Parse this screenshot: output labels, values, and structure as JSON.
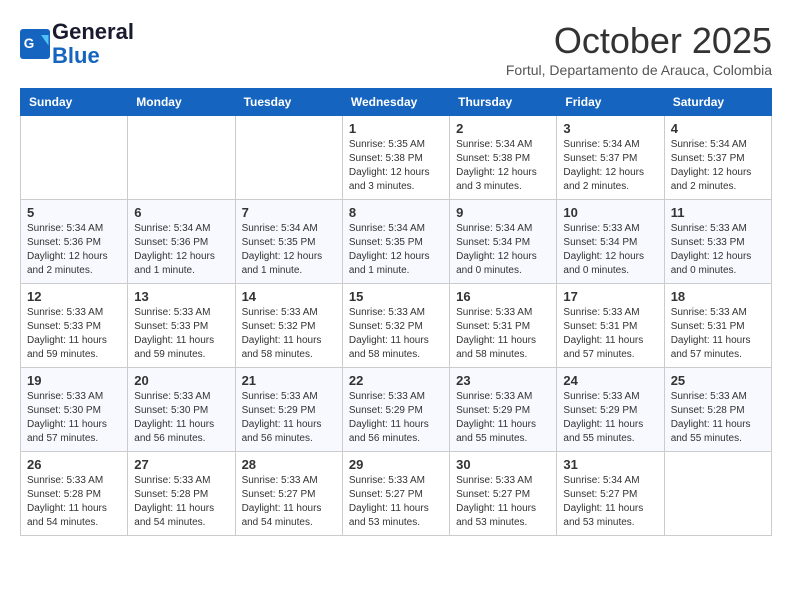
{
  "header": {
    "logo_general": "General",
    "logo_blue": "Blue",
    "month_title": "October 2025",
    "subtitle": "Fortul, Departamento de Arauca, Colombia"
  },
  "days_of_week": [
    "Sunday",
    "Monday",
    "Tuesday",
    "Wednesday",
    "Thursday",
    "Friday",
    "Saturday"
  ],
  "weeks": [
    [
      {
        "day": "",
        "content": ""
      },
      {
        "day": "",
        "content": ""
      },
      {
        "day": "",
        "content": ""
      },
      {
        "day": "1",
        "content": "Sunrise: 5:35 AM\nSunset: 5:38 PM\nDaylight: 12 hours\nand 3 minutes."
      },
      {
        "day": "2",
        "content": "Sunrise: 5:34 AM\nSunset: 5:38 PM\nDaylight: 12 hours\nand 3 minutes."
      },
      {
        "day": "3",
        "content": "Sunrise: 5:34 AM\nSunset: 5:37 PM\nDaylight: 12 hours\nand 2 minutes."
      },
      {
        "day": "4",
        "content": "Sunrise: 5:34 AM\nSunset: 5:37 PM\nDaylight: 12 hours\nand 2 minutes."
      }
    ],
    [
      {
        "day": "5",
        "content": "Sunrise: 5:34 AM\nSunset: 5:36 PM\nDaylight: 12 hours\nand 2 minutes."
      },
      {
        "day": "6",
        "content": "Sunrise: 5:34 AM\nSunset: 5:36 PM\nDaylight: 12 hours\nand 1 minute."
      },
      {
        "day": "7",
        "content": "Sunrise: 5:34 AM\nSunset: 5:35 PM\nDaylight: 12 hours\nand 1 minute."
      },
      {
        "day": "8",
        "content": "Sunrise: 5:34 AM\nSunset: 5:35 PM\nDaylight: 12 hours\nand 1 minute."
      },
      {
        "day": "9",
        "content": "Sunrise: 5:34 AM\nSunset: 5:34 PM\nDaylight: 12 hours\nand 0 minutes."
      },
      {
        "day": "10",
        "content": "Sunrise: 5:33 AM\nSunset: 5:34 PM\nDaylight: 12 hours\nand 0 minutes."
      },
      {
        "day": "11",
        "content": "Sunrise: 5:33 AM\nSunset: 5:33 PM\nDaylight: 12 hours\nand 0 minutes."
      }
    ],
    [
      {
        "day": "12",
        "content": "Sunrise: 5:33 AM\nSunset: 5:33 PM\nDaylight: 11 hours\nand 59 minutes."
      },
      {
        "day": "13",
        "content": "Sunrise: 5:33 AM\nSunset: 5:33 PM\nDaylight: 11 hours\nand 59 minutes."
      },
      {
        "day": "14",
        "content": "Sunrise: 5:33 AM\nSunset: 5:32 PM\nDaylight: 11 hours\nand 58 minutes."
      },
      {
        "day": "15",
        "content": "Sunrise: 5:33 AM\nSunset: 5:32 PM\nDaylight: 11 hours\nand 58 minutes."
      },
      {
        "day": "16",
        "content": "Sunrise: 5:33 AM\nSunset: 5:31 PM\nDaylight: 11 hours\nand 58 minutes."
      },
      {
        "day": "17",
        "content": "Sunrise: 5:33 AM\nSunset: 5:31 PM\nDaylight: 11 hours\nand 57 minutes."
      },
      {
        "day": "18",
        "content": "Sunrise: 5:33 AM\nSunset: 5:31 PM\nDaylight: 11 hours\nand 57 minutes."
      }
    ],
    [
      {
        "day": "19",
        "content": "Sunrise: 5:33 AM\nSunset: 5:30 PM\nDaylight: 11 hours\nand 57 minutes."
      },
      {
        "day": "20",
        "content": "Sunrise: 5:33 AM\nSunset: 5:30 PM\nDaylight: 11 hours\nand 56 minutes."
      },
      {
        "day": "21",
        "content": "Sunrise: 5:33 AM\nSunset: 5:29 PM\nDaylight: 11 hours\nand 56 minutes."
      },
      {
        "day": "22",
        "content": "Sunrise: 5:33 AM\nSunset: 5:29 PM\nDaylight: 11 hours\nand 56 minutes."
      },
      {
        "day": "23",
        "content": "Sunrise: 5:33 AM\nSunset: 5:29 PM\nDaylight: 11 hours\nand 55 minutes."
      },
      {
        "day": "24",
        "content": "Sunrise: 5:33 AM\nSunset: 5:29 PM\nDaylight: 11 hours\nand 55 minutes."
      },
      {
        "day": "25",
        "content": "Sunrise: 5:33 AM\nSunset: 5:28 PM\nDaylight: 11 hours\nand 55 minutes."
      }
    ],
    [
      {
        "day": "26",
        "content": "Sunrise: 5:33 AM\nSunset: 5:28 PM\nDaylight: 11 hours\nand 54 minutes."
      },
      {
        "day": "27",
        "content": "Sunrise: 5:33 AM\nSunset: 5:28 PM\nDaylight: 11 hours\nand 54 minutes."
      },
      {
        "day": "28",
        "content": "Sunrise: 5:33 AM\nSunset: 5:27 PM\nDaylight: 11 hours\nand 54 minutes."
      },
      {
        "day": "29",
        "content": "Sunrise: 5:33 AM\nSunset: 5:27 PM\nDaylight: 11 hours\nand 53 minutes."
      },
      {
        "day": "30",
        "content": "Sunrise: 5:33 AM\nSunset: 5:27 PM\nDaylight: 11 hours\nand 53 minutes."
      },
      {
        "day": "31",
        "content": "Sunrise: 5:34 AM\nSunset: 5:27 PM\nDaylight: 11 hours\nand 53 minutes."
      },
      {
        "day": "",
        "content": ""
      }
    ]
  ]
}
